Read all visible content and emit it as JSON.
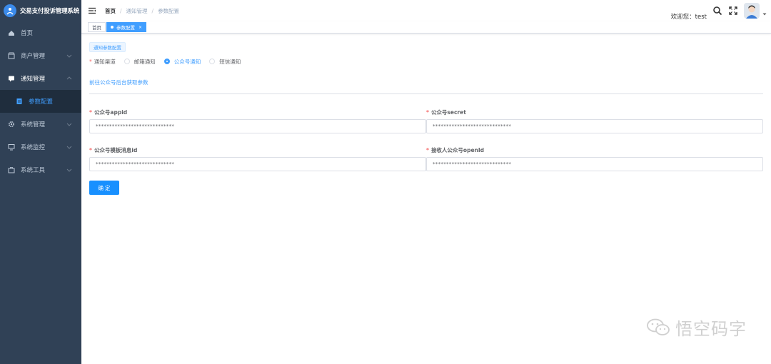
{
  "app": {
    "title": "交易支付投诉管理系统"
  },
  "sidebar": {
    "items": [
      {
        "label": "首页",
        "icon": "dashboard-icon"
      },
      {
        "label": "商户管理",
        "icon": "store-icon"
      },
      {
        "label": "通知管理",
        "icon": "message-icon"
      },
      {
        "label": "参数配置",
        "icon": "document-icon"
      },
      {
        "label": "系统管理",
        "icon": "gear-icon"
      },
      {
        "label": "系统监控",
        "icon": "monitor-icon"
      },
      {
        "label": "系统工具",
        "icon": "toolbox-icon"
      }
    ]
  },
  "header": {
    "breadcrumb": [
      "首页",
      "通知管理",
      "参数配置"
    ],
    "separator": "/",
    "welcome": "欢迎您：test"
  },
  "tags": [
    {
      "label": "首页"
    },
    {
      "label": "参数配置"
    }
  ],
  "main": {
    "section_tab": "通知参数配置",
    "channel": {
      "label": "通知渠道",
      "options": [
        "邮箱通知",
        "公众号通知",
        "短信通知"
      ],
      "selected": "公众号通知"
    },
    "link_text": "前往公众号后台获取参数",
    "fields": [
      {
        "label": "公众号appid",
        "value": "*****************************"
      },
      {
        "label": "公众号secret",
        "value": "*****************************"
      },
      {
        "label": "公众号模板消息id",
        "value": "*****************************"
      },
      {
        "label": "接收人公众号openId",
        "value": "*****************************"
      }
    ],
    "required_mark": "*",
    "confirm_label": "确 定"
  },
  "watermark": {
    "text": "悟空码字"
  },
  "colors": {
    "sidebar_bg": "#304156",
    "primary": "#409eff",
    "required": "#f56c6c"
  }
}
